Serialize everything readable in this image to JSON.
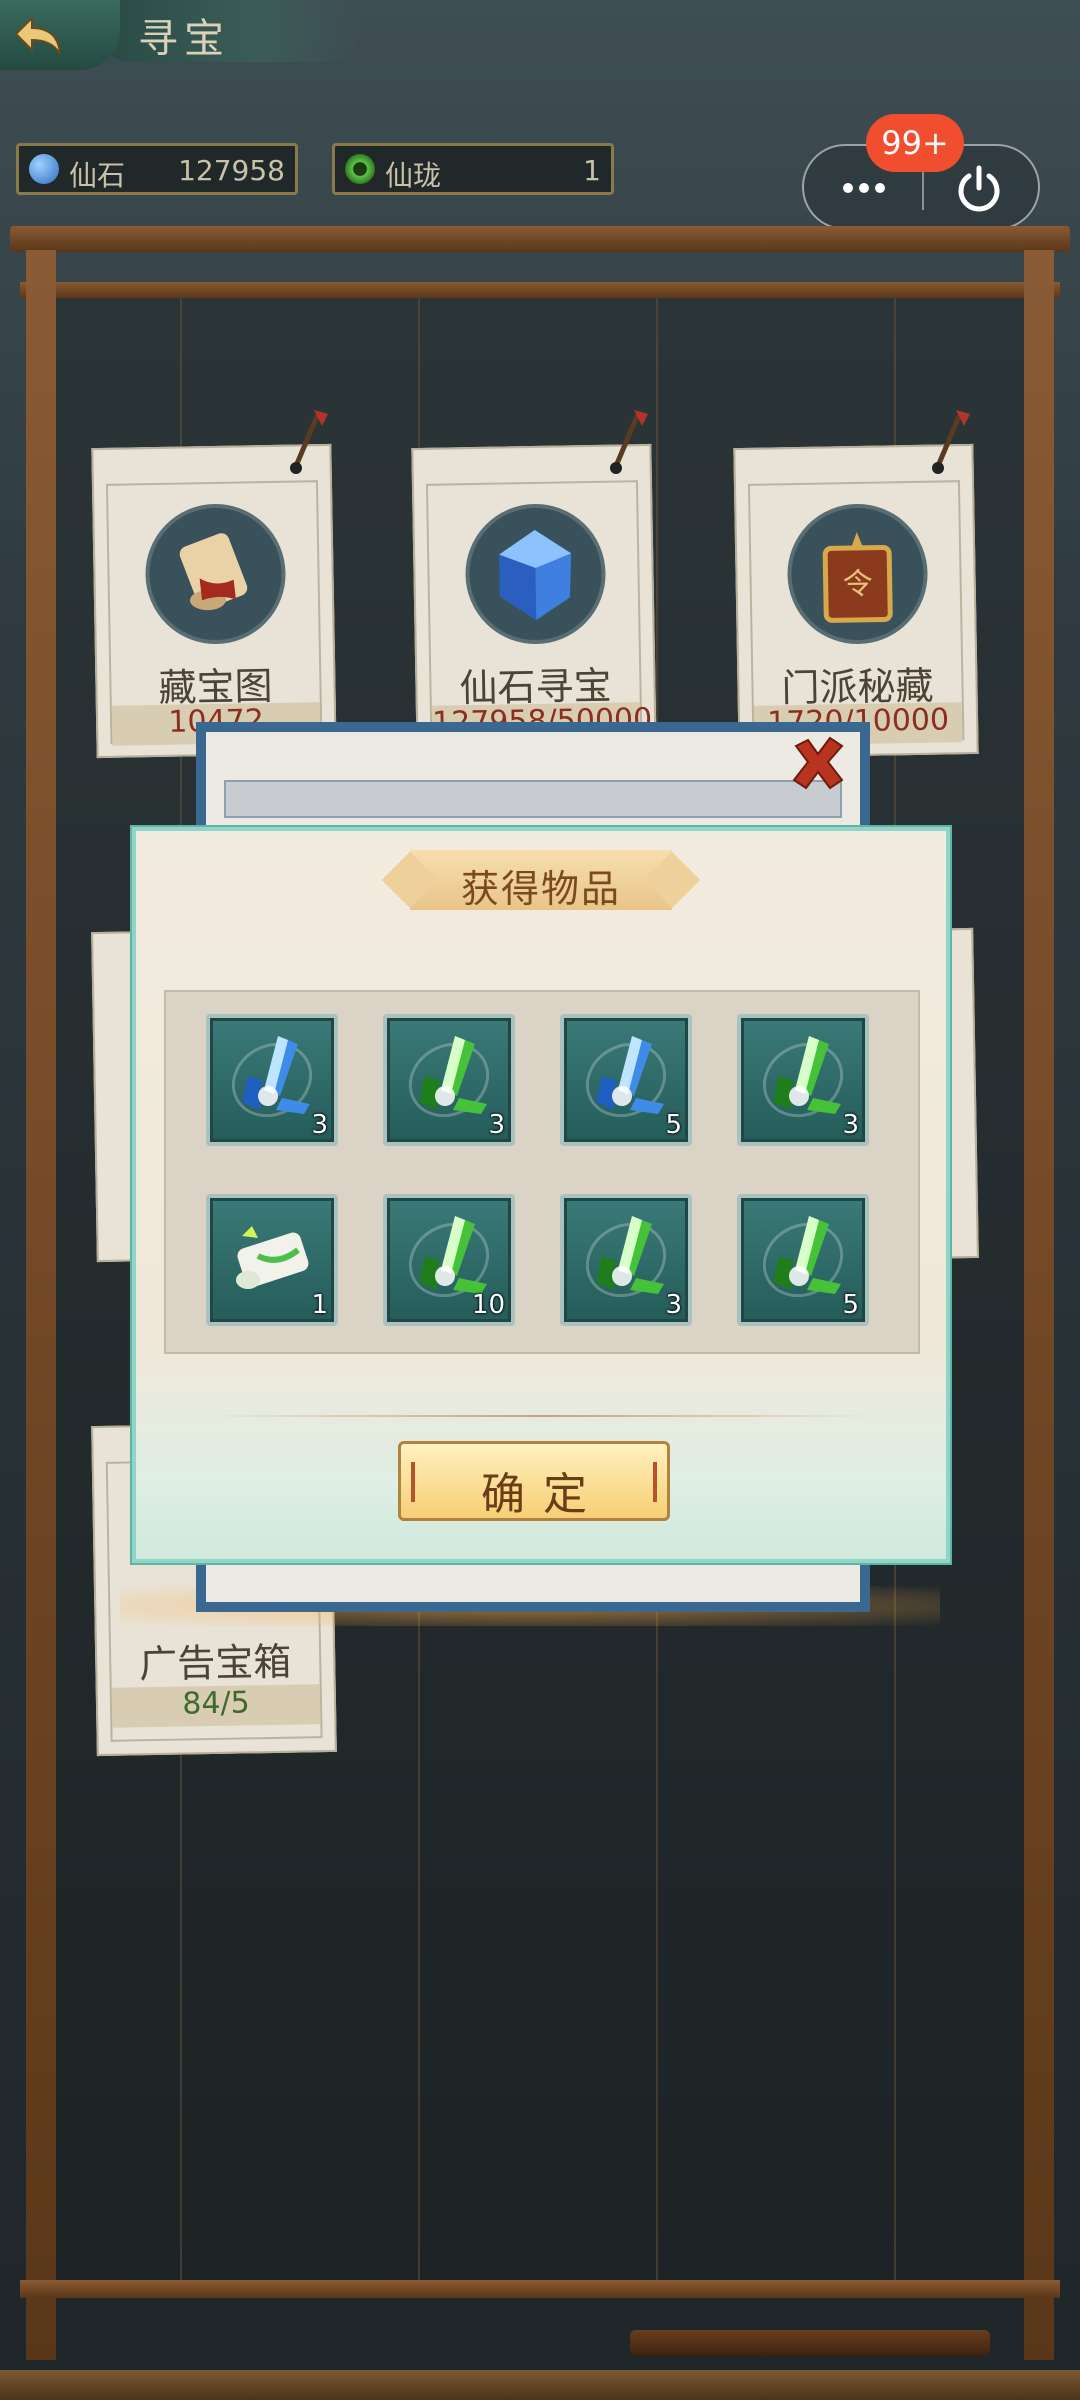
{
  "header": {
    "title": "寻宝"
  },
  "currencies": [
    {
      "label": "仙石",
      "value": "127958",
      "icon": "blue-gem-icon",
      "color": "#3e86d6"
    },
    {
      "label": "仙珑",
      "value": "1",
      "icon": "green-orb-icon",
      "color": "#3fae3a"
    }
  ],
  "capsule": {
    "badge": "99+",
    "more_icon": "more-dots-icon",
    "close_icon": "power-icon"
  },
  "cards": [
    {
      "name": "藏宝图",
      "count": "10472",
      "icon": "treasure-scroll-icon"
    },
    {
      "name": "仙石寻宝",
      "count": "127958/50000",
      "icon": "blue-gem-icon"
    },
    {
      "name": "门派秘藏",
      "count": "1720/10000",
      "icon": "sect-token-icon"
    },
    {
      "name": "广告宝箱",
      "count": "84/5",
      "icon": "ad-chest-icon"
    }
  ],
  "modal": {
    "title": "获得物品",
    "confirm_label": "确定",
    "items": [
      {
        "type": "blue-crystal",
        "qty": "3"
      },
      {
        "type": "green-crystal",
        "qty": "3"
      },
      {
        "type": "blue-crystal",
        "qty": "5"
      },
      {
        "type": "green-crystal",
        "qty": "3"
      },
      {
        "type": "scroll",
        "qty": "1"
      },
      {
        "type": "green-crystal",
        "qty": "10"
      },
      {
        "type": "green-crystal",
        "qty": "3"
      },
      {
        "type": "green-crystal",
        "qty": "5"
      }
    ]
  },
  "colors": {
    "accent": "#f04e2e",
    "modal_border": "#8fd6c8",
    "button": "#f7cf74"
  }
}
